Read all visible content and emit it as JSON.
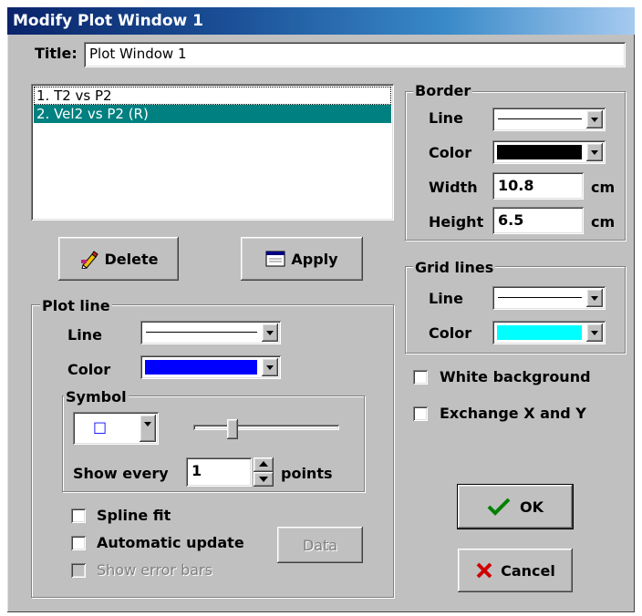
{
  "window": {
    "title": "Modify Plot Window 1"
  },
  "title_field": {
    "label": "Title:",
    "value": "Plot Window 1"
  },
  "plot_list": {
    "items": [
      "1.  T2 vs P2",
      "2.  Vel2 vs P2 (R)"
    ],
    "selected_index": 1
  },
  "buttons": {
    "delete": "Delete",
    "apply": "Apply",
    "data": "Data",
    "ok": "OK",
    "cancel": "Cancel"
  },
  "border": {
    "group_label": "Border",
    "line_label": "Line",
    "color_label": "Color",
    "color_value": "#000000",
    "width_label": "Width",
    "width_value": "10.8",
    "width_unit": "cm",
    "height_label": "Height",
    "height_value": "6.5",
    "height_unit": "cm"
  },
  "grid": {
    "group_label": "Grid lines",
    "line_label": "Line",
    "color_label": "Color",
    "color_value": "#00ffff"
  },
  "options": {
    "white_background": {
      "label": "White background",
      "checked": false
    },
    "exchange_xy": {
      "label": "Exchange X and Y",
      "checked": false
    }
  },
  "plot_line": {
    "group_label": "Plot line",
    "line_label": "Line",
    "color_label": "Color",
    "color_value": "#0000ff",
    "symbol": {
      "group_label": "Symbol",
      "selected": "□",
      "slider_level": 0.25,
      "show_every_label": "Show every",
      "show_every_value": "1",
      "points_label": "points"
    },
    "spline_fit": {
      "label": "Spline fit",
      "checked": false
    },
    "automatic_update": {
      "label": "Automatic update",
      "checked": false
    },
    "show_error_bars": {
      "label": "Show error bars",
      "checked": false,
      "disabled": true
    }
  },
  "colors": {
    "selection": "#008080",
    "titlebar_start": "#0a246a",
    "face": "#c0c0c0"
  }
}
